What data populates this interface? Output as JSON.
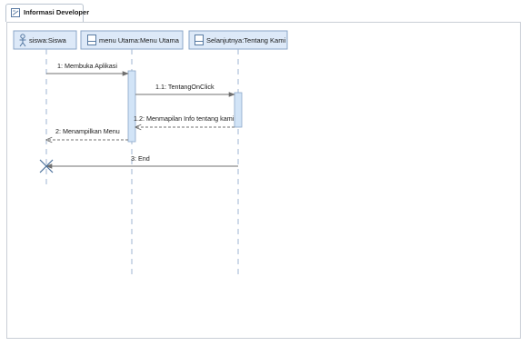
{
  "tab": {
    "title": "Informasi Developer",
    "icon": "sequence-diagram-icon"
  },
  "diagram": {
    "type": "sequence",
    "lifelines": [
      {
        "id": "siswa",
        "label": "siswa:Siswa",
        "icon": "actor-icon"
      },
      {
        "id": "menu",
        "label": "menu Utama:Menu Utama",
        "icon": "boundary-class-icon"
      },
      {
        "id": "tentang",
        "label": "Selanjutnya:Tentang Kami",
        "icon": "boundary-class-icon"
      }
    ],
    "messages": [
      {
        "number": "1",
        "label": "1: Membuka Aplikasi",
        "from": "siswa",
        "to": "menu",
        "kind": "sync"
      },
      {
        "number": "1.1",
        "label": "1.1: TentangOnClick",
        "from": "menu",
        "to": "tentang",
        "kind": "sync"
      },
      {
        "number": "1.2",
        "label": "1.2: Menmapilan Info tentang kami",
        "from": "tentang",
        "to": "menu",
        "kind": "return"
      },
      {
        "number": "2",
        "label": "2: Menampilkan Menu",
        "from": "menu",
        "to": "siswa",
        "kind": "return"
      },
      {
        "number": "3",
        "label": "3: End",
        "from": "tentang",
        "to": "siswa",
        "kind": "destroy"
      }
    ],
    "colors": {
      "lifeline_box_fill": "#dde9f8",
      "lifeline_box_stroke": "#8aa6c8",
      "lifeline_dash": "#9fb6d3",
      "activation_fill": "#d2e4f7",
      "message_line": "#707070",
      "text": "#1a1a1a",
      "destroy_mark": "#4a6f9a"
    }
  }
}
